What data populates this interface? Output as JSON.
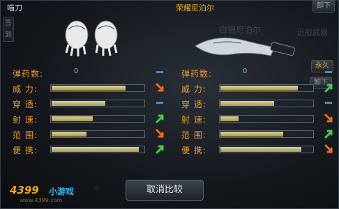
{
  "left": {
    "name": "喵刀",
    "side_tag": "签到",
    "stats": [
      {
        "label": "弹药数:",
        "ammo": "0",
        "level": null,
        "indicator": "dash"
      },
      {
        "label": "威  力:",
        "level": 0.8,
        "indicator": "down-orange"
      },
      {
        "label": "穿  透:",
        "level": 0.58,
        "indicator": "dash"
      },
      {
        "label": "射  速:",
        "level": 0.45,
        "indicator": "up-green"
      },
      {
        "label": "范  围:",
        "level": 0.38,
        "indicator": "down-orange"
      },
      {
        "label": "便  携:",
        "level": 0.95,
        "indicator": "up-green"
      }
    ]
  },
  "right": {
    "name": "荣耀尼泊尔",
    "bg_name": "白银尼泊尔",
    "category": "近战武器",
    "top_button": "卸下",
    "side_button_1": "永久",
    "side_button_2": "卸下",
    "stats": [
      {
        "label": "弹药数:",
        "ammo": "0",
        "level": null,
        "indicator": "dash"
      },
      {
        "label": "威  力:",
        "level": 0.84,
        "indicator": "up-green"
      },
      {
        "label": "穿  透:",
        "level": 0.58,
        "indicator": "dash"
      },
      {
        "label": "射  速:",
        "level": 0.2,
        "indicator": "down-orange"
      },
      {
        "label": "范  围:",
        "level": 0.68,
        "indicator": "up-green"
      },
      {
        "label": "便  携:",
        "level": 0.88,
        "indicator": "down-orange"
      }
    ]
  },
  "bottom": {
    "cancel_compare": "取消比较"
  },
  "logo": {
    "brand": "4399",
    "sub": "小游戏",
    "url": "www.4399.com"
  },
  "colors": {
    "label": "#ef9a2a",
    "fill": "#c8bb70",
    "up": "#3bd04a",
    "down": "#f06a1a",
    "dash": "#3d8fc9"
  }
}
